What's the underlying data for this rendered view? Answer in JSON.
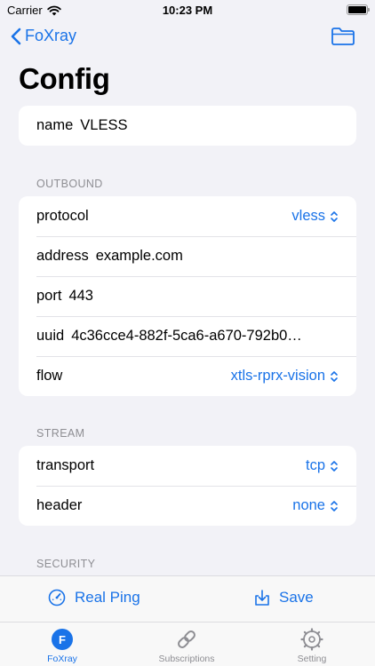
{
  "status_bar": {
    "carrier": "Carrier",
    "time": "10:23 PM"
  },
  "nav": {
    "back_label": "FoXray"
  },
  "title": "Config",
  "name_card": {
    "label": "name",
    "value": "VLESS"
  },
  "outbound": {
    "header": "OUTBOUND",
    "protocol": {
      "label": "protocol",
      "value": "vless"
    },
    "address": {
      "label": "address",
      "value": "example.com"
    },
    "port": {
      "label": "port",
      "value": "443"
    },
    "uuid": {
      "label": "uuid",
      "value": "4c36cce4-882f-5ca6-a670-792b0…"
    },
    "flow": {
      "label": "flow",
      "value": "xtls-rprx-vision"
    }
  },
  "stream": {
    "header": "STREAM",
    "transport": {
      "label": "transport",
      "value": "tcp"
    },
    "header_row": {
      "label": "header",
      "value": "none"
    }
  },
  "security": {
    "header": "SECURITY"
  },
  "actions": {
    "real_ping": "Real Ping",
    "save": "Save"
  },
  "tabs": [
    {
      "label": "FoXray",
      "icon": "f-circle-icon"
    },
    {
      "label": "Subscriptions",
      "icon": "link-icon"
    },
    {
      "label": "Setting",
      "icon": "gear-icon"
    }
  ],
  "colors": {
    "accent": "#1a73e8",
    "background": "#f2f2f7",
    "secondary_text": "#8e8e93"
  }
}
